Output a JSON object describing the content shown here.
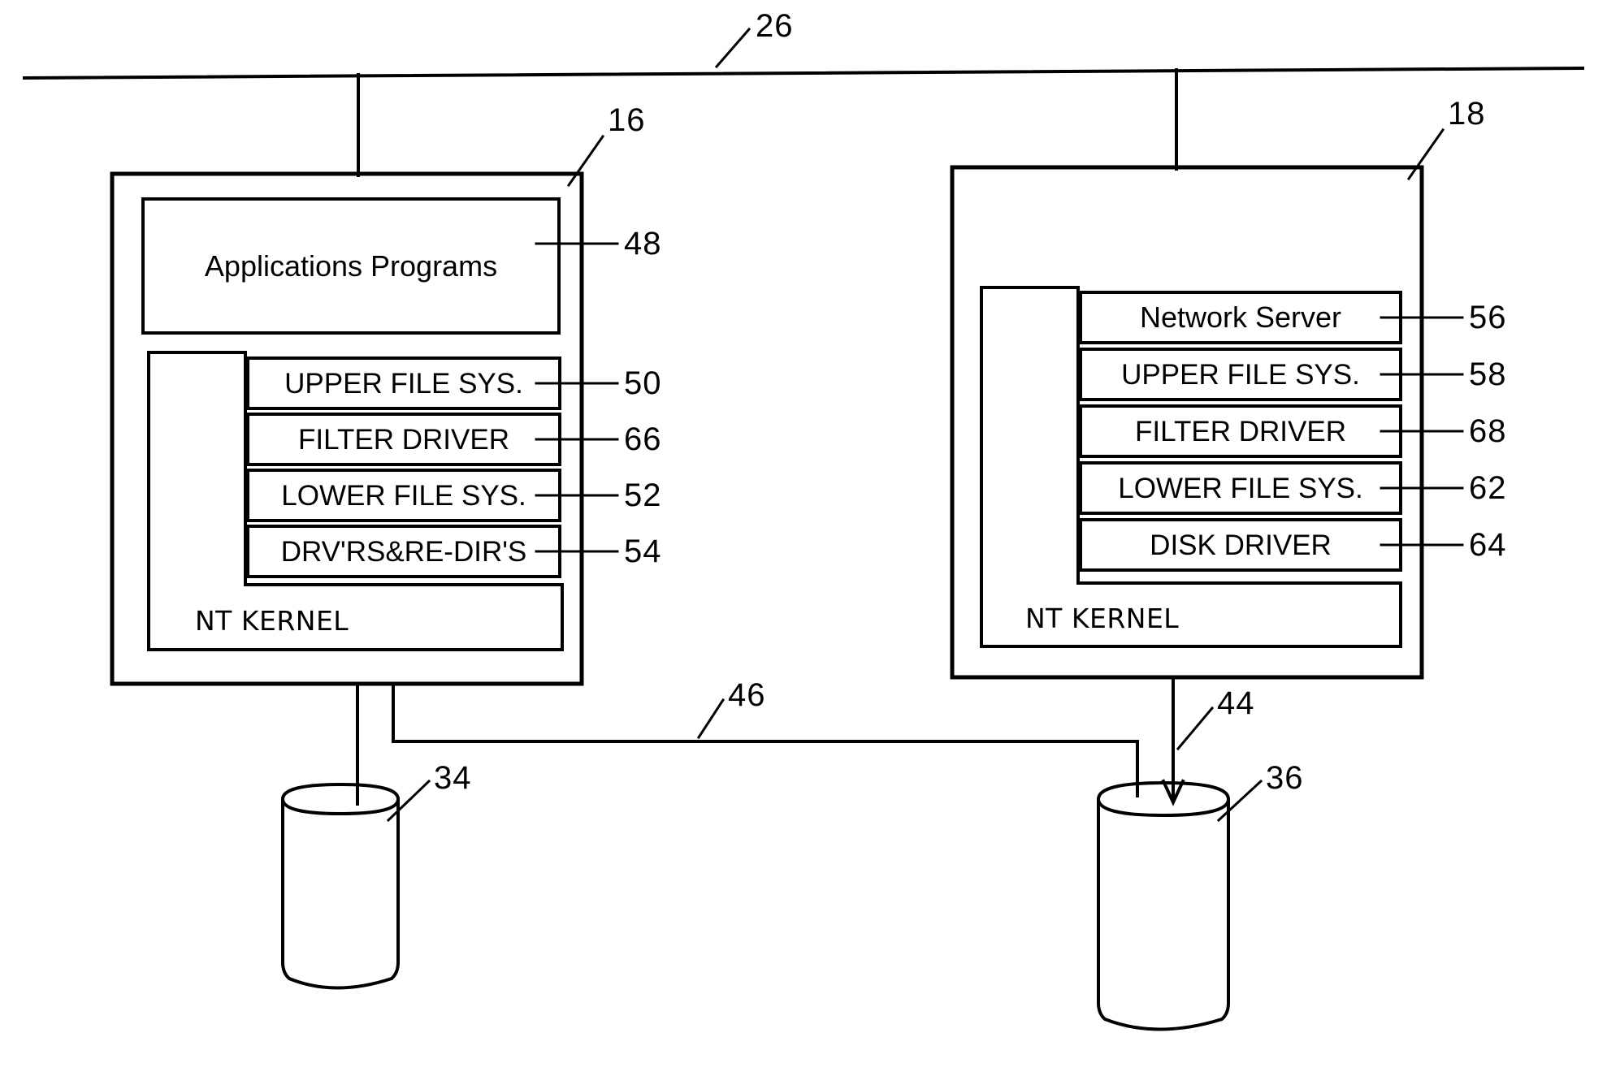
{
  "figure": {
    "type": "patent-block-diagram",
    "background": "#ffffff",
    "line_color": "#000000"
  },
  "network": {
    "bus_ref": "26"
  },
  "workstation": {
    "ref": "16",
    "blocks": [
      {
        "label": "Applications Programs",
        "ref": "48",
        "style": "mixed"
      },
      {
        "label": "UPPER FILE SYS.",
        "ref": "50",
        "style": "caps"
      },
      {
        "label": "FILTER DRIVER",
        "ref": "66",
        "style": "caps"
      },
      {
        "label": "LOWER FILE SYS.",
        "ref": "52",
        "style": "caps"
      },
      {
        "label": "DRV'RS&RE-DIR'S",
        "ref": "54",
        "style": "caps"
      }
    ],
    "kernel_label": "NT  KERNEL",
    "disk": {
      "ref": "34"
    }
  },
  "server": {
    "ref": "18",
    "blocks": [
      {
        "label": "Network Server",
        "ref": "56",
        "style": "mixed"
      },
      {
        "label": "UPPER FILE SYS.",
        "ref": "58",
        "style": "caps"
      },
      {
        "label": "FILTER DRIVER",
        "ref": "68",
        "style": "caps"
      },
      {
        "label": "LOWER FILE SYS.",
        "ref": "62",
        "style": "caps"
      },
      {
        "label": "DISK DRIVER",
        "ref": "64",
        "style": "caps"
      }
    ],
    "kernel_label": "NT  KERNEL",
    "disk": {
      "ref": "36"
    }
  },
  "connections": {
    "shared_bus_ref": "46",
    "server_disk_link_ref": "44"
  }
}
